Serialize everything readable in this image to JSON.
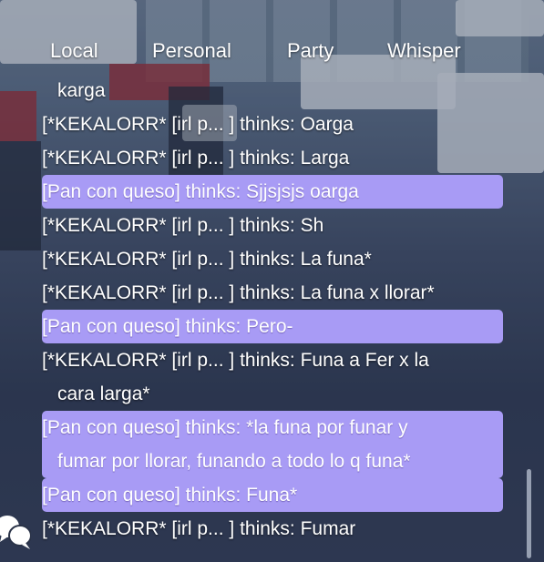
{
  "tabs": [
    "Local",
    "Personal",
    "Party",
    "Whisper"
  ],
  "messages": [
    {
      "line1": "[*KEKALORR* [irl p... ] thinks: Oarga",
      "line2": "karga",
      "highlight": false
    },
    {
      "line1": "[*KEKALORR* [irl p... ] thinks: Oarga",
      "highlight": false
    },
    {
      "line1": "[*KEKALORR* [irl p... ] thinks: Larga",
      "highlight": false
    },
    {
      "line1": "[Pan con queso] thinks: Sjjsjsjs oarga",
      "highlight": true
    },
    {
      "line1": "[*KEKALORR* [irl p... ] thinks: Sh",
      "highlight": false
    },
    {
      "line1": "[*KEKALORR* [irl p... ] thinks: La funa*",
      "highlight": false
    },
    {
      "line1": "[*KEKALORR* [irl p... ] thinks: La funa x llorar*",
      "highlight": false
    },
    {
      "line1": "[Pan con queso] thinks: Pero-",
      "highlight": true
    },
    {
      "line1": "[*KEKALORR* [irl p... ] thinks: Funa a Fer x la",
      "line2": "cara larga*",
      "highlight": false
    },
    {
      "line1": "[Pan con queso] thinks: *la funa por funar y",
      "line2": "fumar por llorar, funando a todo lo q funa*",
      "highlight": true
    },
    {
      "line1": "[Pan con queso] thinks: Funa*",
      "highlight": true
    },
    {
      "line1": "[*KEKALORR* [irl p... ] thinks: Fumar",
      "highlight": false
    }
  ],
  "colors": {
    "highlight": "#a89bf5",
    "text": "#ffffff"
  },
  "icons": {
    "chat": "speech-bubbles-icon"
  }
}
